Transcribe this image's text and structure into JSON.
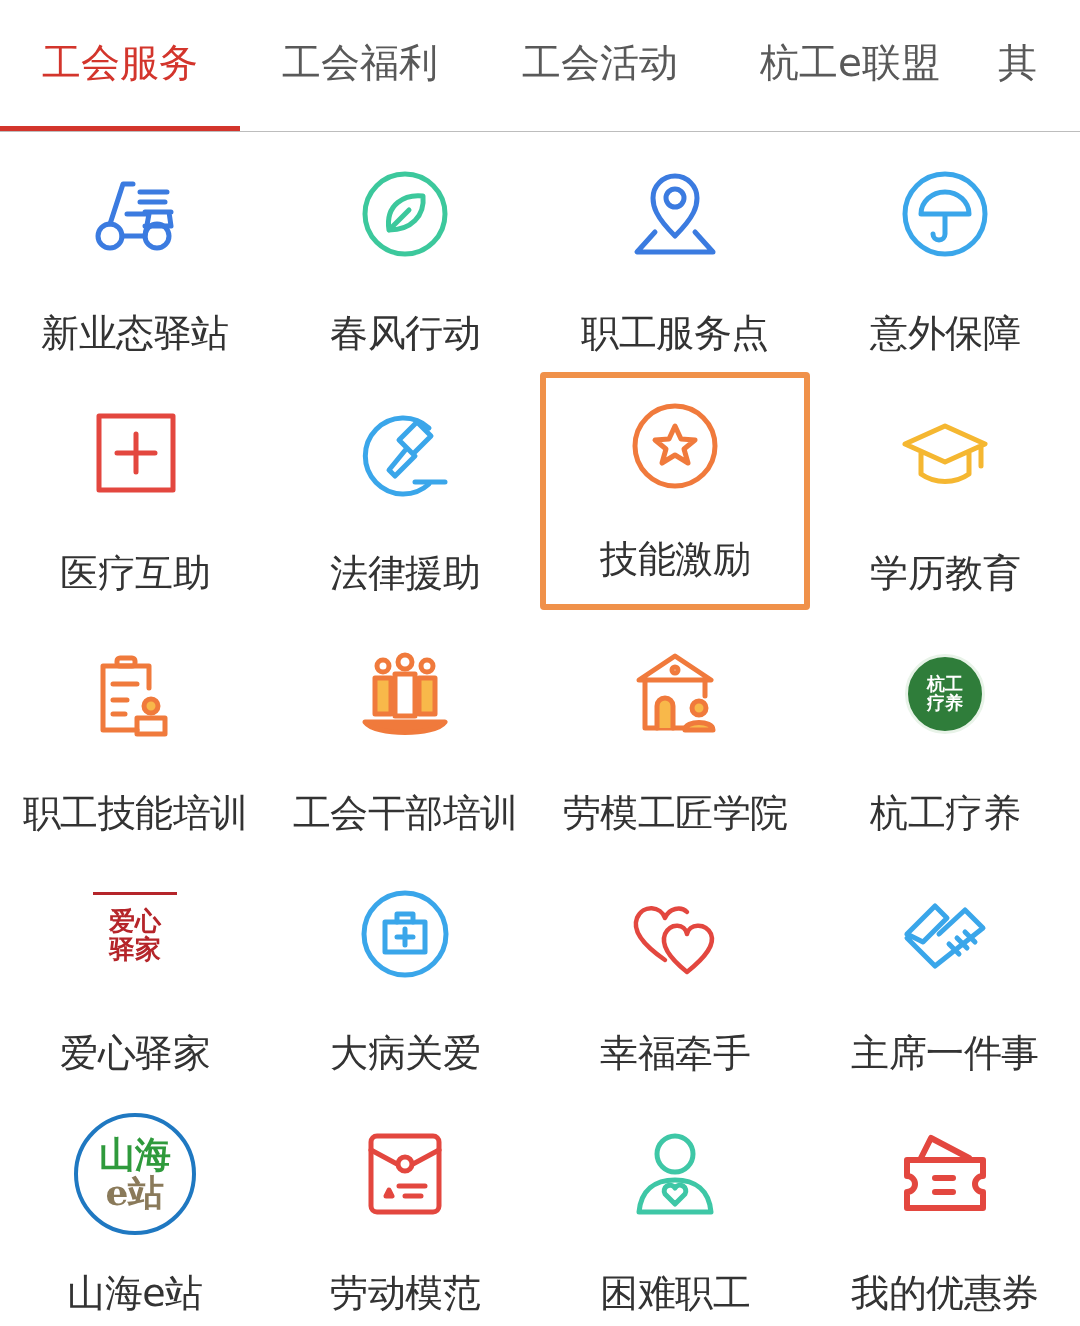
{
  "tabs": [
    {
      "label": "工会服务",
      "selected": true
    },
    {
      "label": "工会福利",
      "selected": false
    },
    {
      "label": "工会活动",
      "selected": false
    },
    {
      "label": "杭工e联盟",
      "selected": false
    },
    {
      "label": "其",
      "selected": false
    }
  ],
  "services": [
    {
      "label": "新业态驿站",
      "highlighted": false
    },
    {
      "label": "春风行动",
      "highlighted": false
    },
    {
      "label": "职工服务点",
      "highlighted": false
    },
    {
      "label": "意外保障",
      "highlighted": false
    },
    {
      "label": "医疗互助",
      "highlighted": false
    },
    {
      "label": "法律援助",
      "highlighted": false
    },
    {
      "label": "技能激励",
      "highlighted": true
    },
    {
      "label": "学历教育",
      "highlighted": false
    },
    {
      "label": "职工技能培训",
      "highlighted": false
    },
    {
      "label": "工会干部培训",
      "highlighted": false
    },
    {
      "label": "劳模工匠学院",
      "highlighted": false
    },
    {
      "label": "杭工疗养",
      "highlighted": false,
      "logo_text": [
        "杭工",
        "疗养"
      ]
    },
    {
      "label": "爱心驿家",
      "highlighted": false,
      "logo_text": [
        "爱心",
        "驿家"
      ]
    },
    {
      "label": "大病关爱",
      "highlighted": false
    },
    {
      "label": "幸福牵手",
      "highlighted": false
    },
    {
      "label": "主席一件事",
      "highlighted": false
    },
    {
      "label": "山海e站",
      "highlighted": false,
      "logo_text": [
        "山海",
        "e站"
      ]
    },
    {
      "label": "劳动模范",
      "highlighted": false
    },
    {
      "label": "困难职工",
      "highlighted": false
    },
    {
      "label": "我的优惠券",
      "highlighted": false
    }
  ]
}
